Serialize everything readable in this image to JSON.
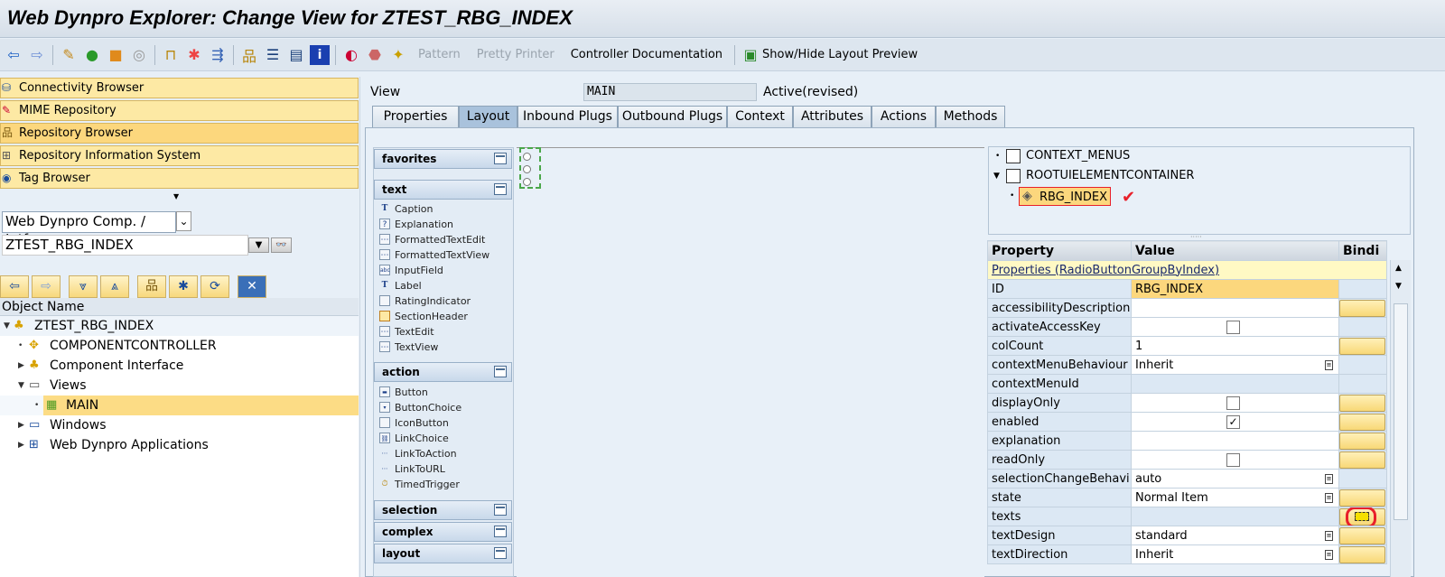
{
  "window": {
    "title": "Web Dynpro Explorer: Change View for ZTEST_RBG_INDEX"
  },
  "toolbar": {
    "icons": [
      "back-arrow",
      "forward-arrow",
      "edit-pencil",
      "switch-display",
      "other-object",
      "where-used",
      "navigate-object",
      "check",
      "activate",
      "object-list",
      "display-list",
      "info",
      "test",
      "delete",
      "wizard"
    ],
    "pattern": "Pattern",
    "pretty_printer": "Pretty Printer",
    "controller_documentation": "Controller Documentation",
    "show_hide_layout_preview": "Show/Hide Layout Preview"
  },
  "nav": {
    "items": [
      {
        "label": "Connectivity Browser",
        "selected": false
      },
      {
        "label": "MIME Repository",
        "selected": false
      },
      {
        "label": "Repository Browser",
        "selected": true
      },
      {
        "label": "Repository Information System",
        "selected": false
      },
      {
        "label": "Tag Browser",
        "selected": false
      }
    ]
  },
  "repo": {
    "object_type": "Web Dynpro Comp. / Intf.",
    "object_name": "ZTEST_RBG_INDEX",
    "column_header": "Object Name",
    "tree": [
      {
        "label": "ZTEST_RBG_INDEX",
        "level": 0,
        "expanded": true,
        "icon": "component-icon"
      },
      {
        "label": "COMPONENTCONTROLLER",
        "level": 1,
        "icon": "controller-icon"
      },
      {
        "label": "Component Interface",
        "level": 1,
        "icon": "interface-icon"
      },
      {
        "label": "Views",
        "level": 1,
        "expanded": true,
        "icon": "views-icon"
      },
      {
        "label": "MAIN",
        "level": 2,
        "selected": true,
        "icon": "view-icon"
      },
      {
        "label": "Windows",
        "level": 1,
        "icon": "windows-icon"
      },
      {
        "label": "Web Dynpro Applications",
        "level": 1,
        "icon": "applications-icon"
      }
    ]
  },
  "view": {
    "label": "View",
    "name": "MAIN",
    "status": "Active(revised)"
  },
  "tabs": [
    {
      "label": "Properties"
    },
    {
      "label": "Layout",
      "active": true
    },
    {
      "label": "Inbound Plugs"
    },
    {
      "label": "Outbound Plugs"
    },
    {
      "label": "Context"
    },
    {
      "label": "Attributes"
    },
    {
      "label": "Actions"
    },
    {
      "label": "Methods"
    }
  ],
  "palette": {
    "favorites": "favorites",
    "text": {
      "header": "text",
      "items": [
        "Caption",
        "Explanation",
        "FormattedTextEdit",
        "FormattedTextView",
        "InputField",
        "Label",
        "RatingIndicator",
        "SectionHeader",
        "TextEdit",
        "TextView"
      ]
    },
    "action": {
      "header": "action",
      "items": [
        "Button",
        "ButtonChoice",
        "IconButton",
        "LinkChoice",
        "LinkToAction",
        "LinkToURL",
        "TimedTrigger"
      ]
    },
    "selection": "selection",
    "complex": "complex",
    "layout": "layout"
  },
  "outline": [
    {
      "label": "CONTEXT_MENUS"
    },
    {
      "label": "ROOTUIELEMENTCONTAINER"
    },
    {
      "label": "RBG_INDEX",
      "selected": true
    }
  ],
  "properties": {
    "headers": [
      "Property",
      "Value",
      "Bindi"
    ],
    "group": "Properties (RadioButtonGroupByIndex)",
    "rows": [
      {
        "name": "ID",
        "value": "RBG_INDEX",
        "type": "id",
        "binding": false
      },
      {
        "name": "accessibilityDescription",
        "value": "",
        "type": "text",
        "binding": true
      },
      {
        "name": "activateAccessKey",
        "value": "",
        "type": "checkbox",
        "checked": false,
        "binding": false
      },
      {
        "name": "colCount",
        "value": "1",
        "type": "text",
        "binding": true
      },
      {
        "name": "contextMenuBehaviour",
        "value": "Inherit",
        "type": "dropdown",
        "binding": false
      },
      {
        "name": "contextMenuId",
        "value": "",
        "type": "empty",
        "binding": false
      },
      {
        "name": "displayOnly",
        "value": "",
        "type": "checkbox",
        "checked": false,
        "binding": true
      },
      {
        "name": "enabled",
        "value": "",
        "type": "checkbox",
        "checked": true,
        "binding": true
      },
      {
        "name": "explanation",
        "value": "",
        "type": "text",
        "binding": true
      },
      {
        "name": "readOnly",
        "value": "",
        "type": "checkbox",
        "checked": false,
        "binding": true
      },
      {
        "name": "selectionChangeBehavi",
        "value": "auto",
        "type": "dropdown",
        "binding": false
      },
      {
        "name": "state",
        "value": "Normal Item",
        "type": "dropdown",
        "binding": true
      },
      {
        "name": "texts",
        "value": "",
        "type": "empty",
        "binding": true,
        "highlighted": true
      },
      {
        "name": "textDesign",
        "value": "standard",
        "type": "dropdown",
        "binding": true
      },
      {
        "name": "textDirection",
        "value": "Inherit",
        "type": "dropdown",
        "binding": true
      }
    ]
  },
  "colors": {
    "nav_bg": "#fde9a4",
    "nav_selected": "#fcd77d",
    "annotation_red": "#e8202a",
    "id_highlight": "#fcd77d"
  }
}
